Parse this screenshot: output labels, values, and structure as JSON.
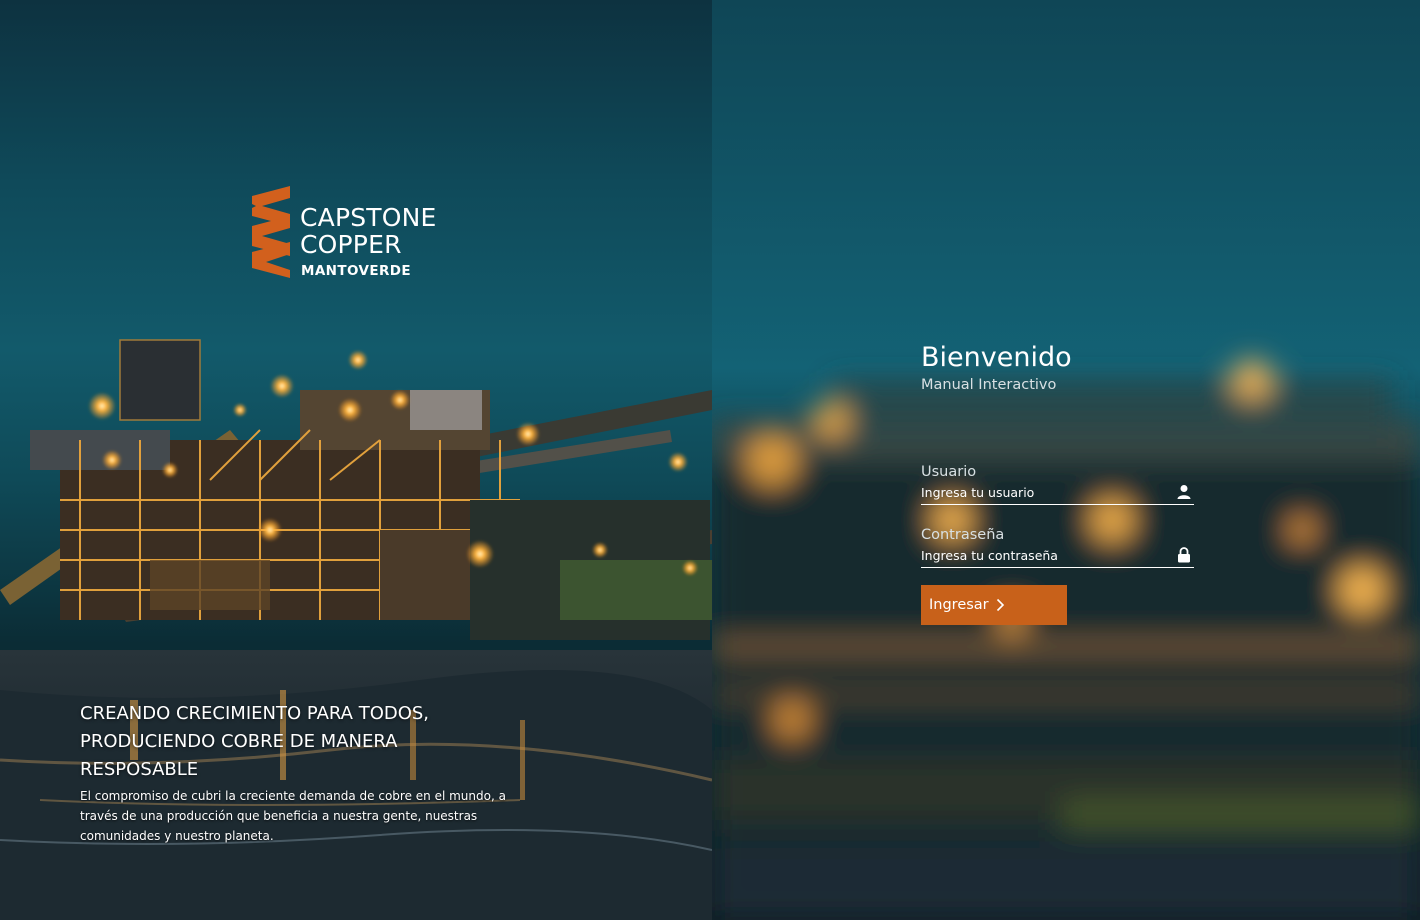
{
  "brand": {
    "line1": "CAPSTONE",
    "line2": "COPPER",
    "line3": "MANTOVERDE",
    "accent_color": "#d2601d"
  },
  "tagline": {
    "title": "CREANDO CRECIMIENTO PARA TODOS, PRODUCIENDO COBRE DE MANERA RESPOSABLE",
    "text": "El compromiso de cubri la creciente demanda de cobre en el mundo, a través de una producción que beneficia a nuestra gente, nuestras comunidades y nuestro planeta."
  },
  "login": {
    "title": "Bienvenido",
    "subtitle": "Manual Interactivo",
    "username": {
      "label": "Usuario",
      "placeholder": "Ingresa tu usuario",
      "value": "",
      "icon": "user-icon"
    },
    "password": {
      "label": "Contraseña",
      "placeholder": "Ingresa tu contraseña",
      "value": "",
      "icon": "lock-icon"
    },
    "submit_label": "Ingresar",
    "submit_icon": "chevron-right-icon",
    "button_color": "#c8611a"
  }
}
